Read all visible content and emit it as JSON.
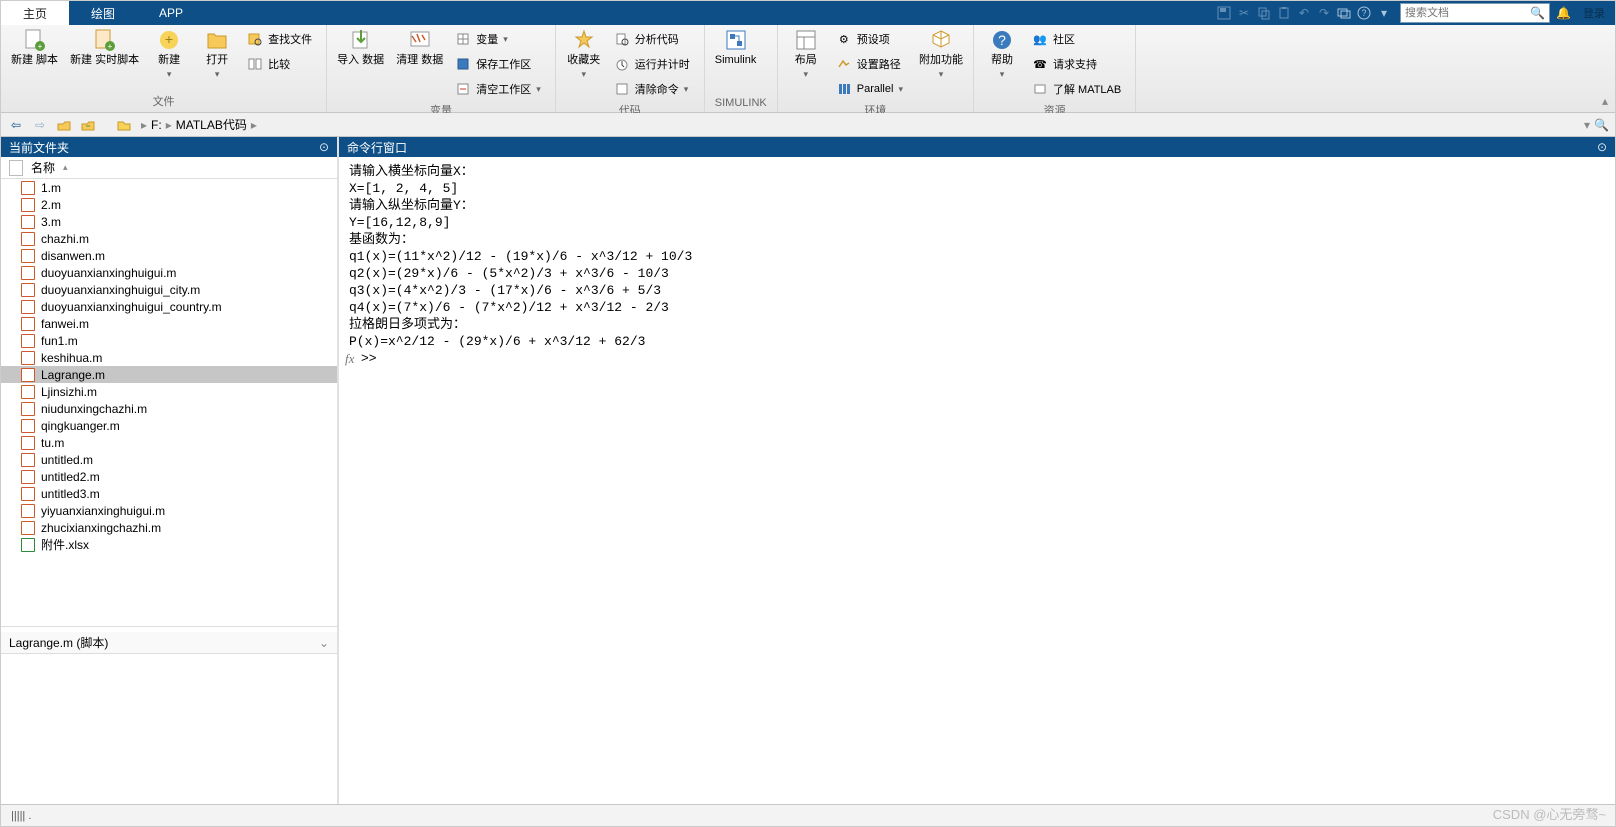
{
  "tabs": {
    "home": "主页",
    "plot": "绘图",
    "app": "APP"
  },
  "search": {
    "placeholder": "搜索文档"
  },
  "login": "登录",
  "ribbon": {
    "file": {
      "new_script": "新建\n脚本",
      "new_live": "新建\n实时脚本",
      "new": "新建",
      "open": "打开",
      "find_files": "查找文件",
      "compare": "比较",
      "name": "文件"
    },
    "var": {
      "import": "导入\n数据",
      "clean": "清理\n数据",
      "variable": "变量",
      "save_ws": "保存工作区",
      "clear_ws": "清空工作区",
      "name": "变量"
    },
    "code": {
      "fav": "收藏夹",
      "analyze": "分析代码",
      "run_time": "运行并计时",
      "clear_cmd": "清除命令",
      "name": "代码"
    },
    "simulink": {
      "btn": "Simulink",
      "name": "SIMULINK"
    },
    "env": {
      "layout": "布局",
      "prefs": "预设项",
      "set_path": "设置路径",
      "parallel": "Parallel",
      "addons": "附加功能",
      "name": "环境"
    },
    "res": {
      "help": "帮助",
      "community": "社区",
      "support": "请求支持",
      "learn": "了解 MATLAB",
      "name": "资源"
    }
  },
  "breadcrumb": {
    "drive": "F:",
    "folder": "MATLAB代码"
  },
  "panels": {
    "folder_title": "当前文件夹",
    "cmd_title": "命令行窗口",
    "name_col": "名称"
  },
  "files": [
    {
      "n": "1.m",
      "t": "m"
    },
    {
      "n": "2.m",
      "t": "m"
    },
    {
      "n": "3.m",
      "t": "m"
    },
    {
      "n": "chazhi.m",
      "t": "m"
    },
    {
      "n": "disanwen.m",
      "t": "m"
    },
    {
      "n": "duoyuanxianxinghuigui.m",
      "t": "m"
    },
    {
      "n": "duoyuanxianxinghuigui_city.m",
      "t": "m"
    },
    {
      "n": "duoyuanxianxinghuigui_country.m",
      "t": "m"
    },
    {
      "n": "fanwei.m",
      "t": "m"
    },
    {
      "n": "fun1.m",
      "t": "m"
    },
    {
      "n": "keshihua.m",
      "t": "m"
    },
    {
      "n": "Lagrange.m",
      "t": "m",
      "sel": true
    },
    {
      "n": "Ljinsizhi.m",
      "t": "m"
    },
    {
      "n": "niudunxingchazhi.m",
      "t": "m"
    },
    {
      "n": "qingkuanger.m",
      "t": "m"
    },
    {
      "n": "tu.m",
      "t": "m"
    },
    {
      "n": "untitled.m",
      "t": "m"
    },
    {
      "n": "untitled2.m",
      "t": "m"
    },
    {
      "n": "untitled3.m",
      "t": "m"
    },
    {
      "n": "yiyuanxianxinghuigui.m",
      "t": "m"
    },
    {
      "n": "zhucixianxingchazhi.m",
      "t": "m"
    },
    {
      "n": "附件.xlsx",
      "t": "xls"
    }
  ],
  "details": "Lagrange.m  (脚本)",
  "cmd_lines": [
    "请输入横坐标向量X：",
    "X=[1, 2, 4, 5]",
    "请输入纵坐标向量Y：",
    "Y=[16,12,8,9]",
    "基函数为：",
    "q1(x)=(11*x^2)/12 - (19*x)/6 - x^3/12 + 10/3",
    "q2(x)=(29*x)/6 - (5*x^2)/3 + x^3/6 - 10/3",
    "q3(x)=(4*x^2)/3 - (17*x)/6 - x^3/6 + 5/3",
    "q4(x)=(7*x)/6 - (7*x^2)/12 + x^3/12 - 2/3",
    "拉格朗日多项式为：",
    "P(x)=x^2/12 - (29*x)/6 + x^3/12 + 62/3"
  ],
  "prompt": ">> ",
  "status": "||||| .",
  "watermark": "CSDN @心无旁骛~"
}
